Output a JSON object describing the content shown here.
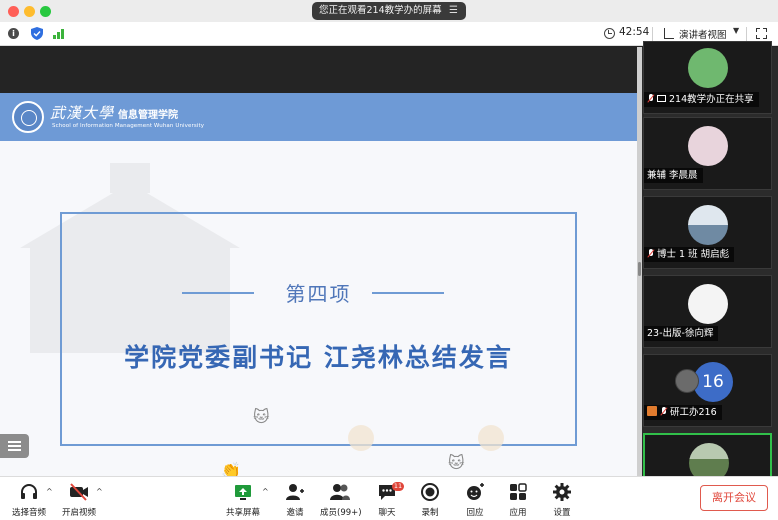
{
  "window": {
    "sharing_banner": "您正在观看214教学办的屏幕"
  },
  "infobar": {
    "timer": "42:54",
    "view_mode": "演讲者视图"
  },
  "slide": {
    "logo_cn": "武漢大學",
    "logo_dept": "信息管理学院",
    "logo_en": "School of Information Management Wuhan University",
    "item_number": "第四项",
    "title": "学院党委副书记  江尧林总结发言"
  },
  "gallery": {
    "tiles": [
      {
        "name": "214教学办正在共享"
      },
      {
        "name": "兼辅 李晨晨"
      },
      {
        "name": "博士 1 班 胡启彪"
      },
      {
        "name": "23-出版-徐向辉"
      },
      {
        "name": "研工办216",
        "count": "16"
      },
      {
        "name": ""
      }
    ]
  },
  "toolbar": {
    "audio_label": "选择音频",
    "video_label": "开启视频",
    "share_label": "共享屏幕",
    "invite_label": "邀请",
    "members_label": "成员(99+)",
    "chat_label": "聊天",
    "chat_badge": "11",
    "record_label": "录制",
    "reactions_label": "回应",
    "apps_label": "应用",
    "settings_label": "设置",
    "leave_label": "离开会议"
  },
  "colors": {
    "slide_blue": "#6e9ad6",
    "title_blue": "#3667b4",
    "active_speaker": "#31c04a",
    "leave_red": "#e0463a",
    "participant_count_badge": "#3d6cc7"
  }
}
